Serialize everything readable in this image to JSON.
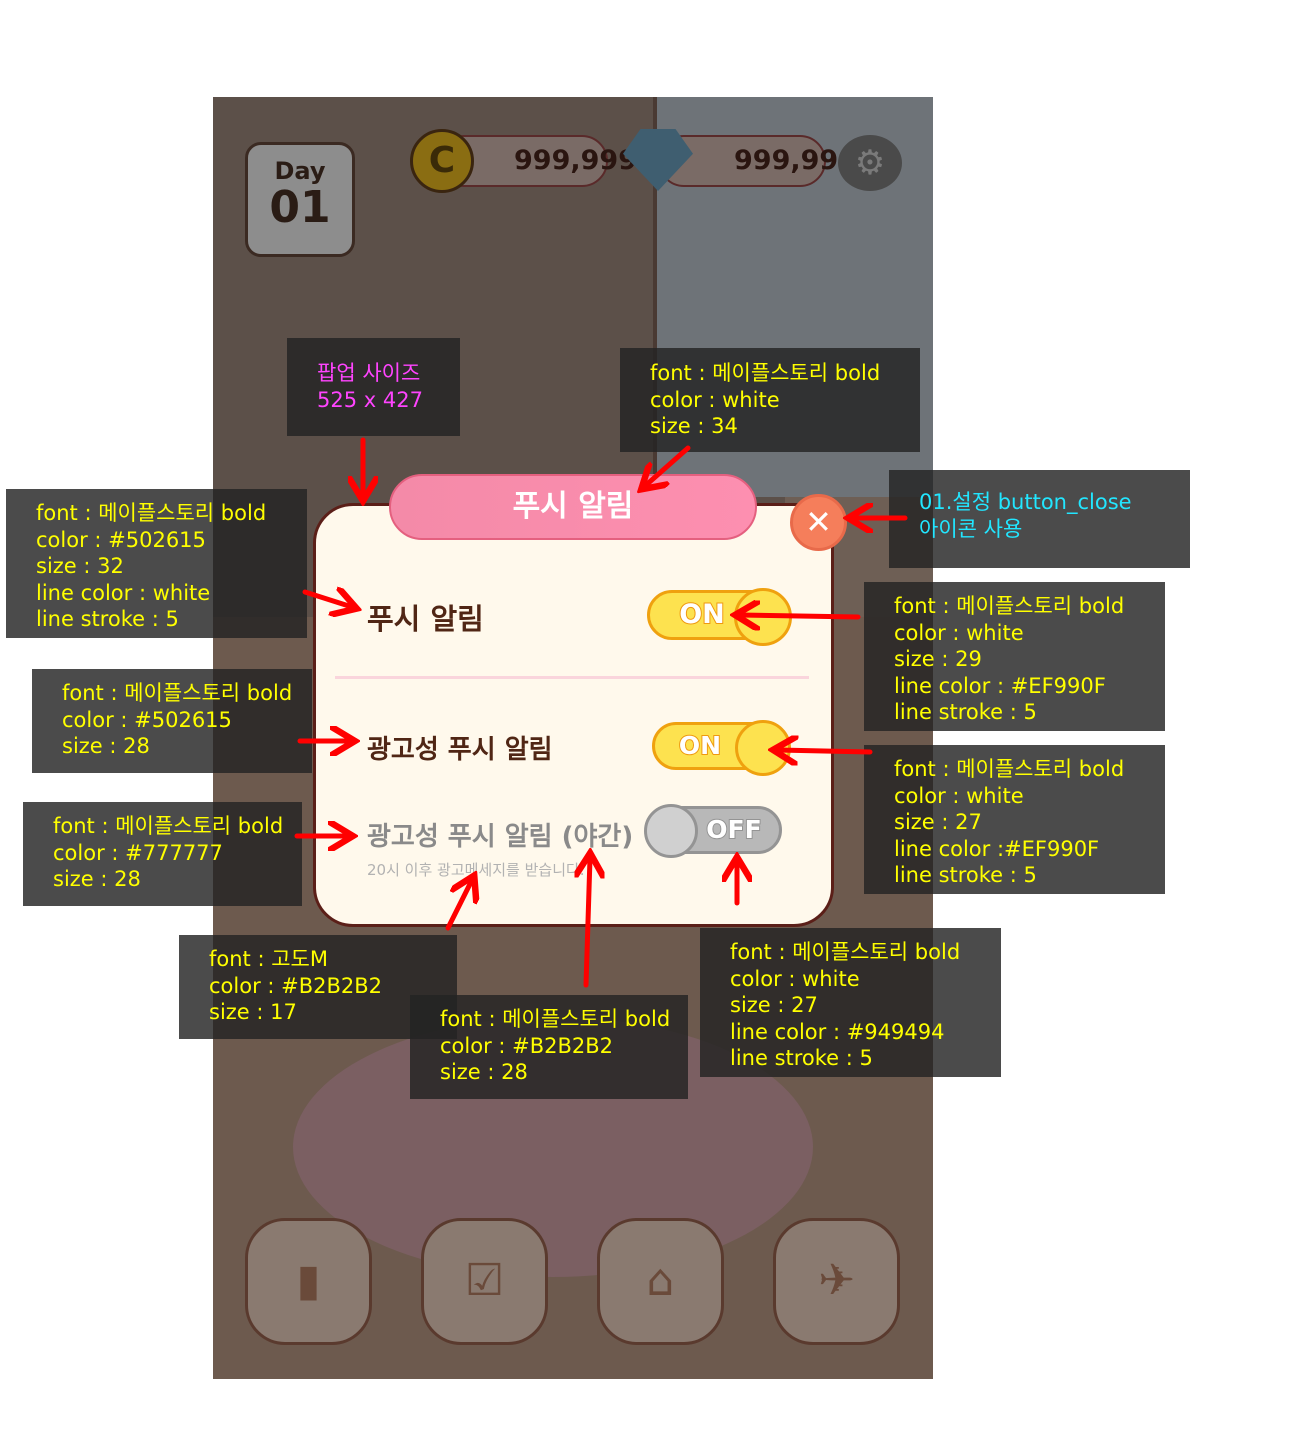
{
  "game": {
    "day_label": "Day",
    "day_number": "01",
    "coin_amount": "999,999",
    "gem_amount": "999,999",
    "icons": {
      "coin": "coin-icon",
      "gem": "diamond-icon",
      "settings": "gear-icon",
      "nav": [
        "chart-icon",
        "checklist-icon",
        "shop-icon",
        "airplane-character-icon"
      ]
    }
  },
  "popup": {
    "title": "푸시 알림",
    "close_icon": "close-x-icon",
    "rows": [
      {
        "label": "푸시 알림",
        "toggle": "ON",
        "state": true
      },
      {
        "label": "광고성 푸시 알림",
        "toggle": "ON",
        "state": true
      },
      {
        "label": "광고성 푸시 알림 (야간)",
        "sublabel": "20시 이후 광고메세지를 받습니다.",
        "toggle": "OFF",
        "state": false
      }
    ]
  },
  "annotations": {
    "popup_size": {
      "line1": "팝업 사이즈",
      "line2": "525 x 427"
    },
    "title": [
      "font : 메이플스토리 bold",
      "color : white",
      "size : 34"
    ],
    "close": [
      "01.설정 button_close",
      "아이콘 사용"
    ],
    "row1_label": [
      "font : 메이플스토리 bold",
      "color : #502615",
      "size : 32",
      "line color : white",
      "line stroke :  5"
    ],
    "row2_label": [
      "font : 메이플스토리 bold",
      "color : #502615",
      "size : 28"
    ],
    "row3_label": [
      "font : 메이플스토리 bold",
      "color : #777777",
      "size : 28"
    ],
    "toggle1": [
      "font : 메이플스토리 bold",
      "color : white",
      "size : 29",
      "line color : #EF990F",
      "line stroke :  5"
    ],
    "toggle2": [
      "font : 메이플스토리 bold",
      "color : white",
      "size : 27",
      "line color :#EF990F",
      "line stroke :  5"
    ],
    "sublabel": [
      "font : 고도M",
      "color : #B2B2B2",
      "size : 17"
    ],
    "row3_suffix": [
      "font : 메이플스토리 bold",
      "color : #B2B2B2",
      "size : 28"
    ],
    "toggle_off": [
      "font : 메이플스토리 bold",
      "color : white",
      "size : 27",
      "line color : #949494",
      "line stroke :  5"
    ]
  },
  "colors": {
    "label": "#502615",
    "label_disabled": "#777777",
    "sub": "#B2B2B2",
    "on_stroke": "#EF990F",
    "off_stroke": "#949494",
    "annotation_text": "#FFFF00",
    "arrow": "#FF0000"
  }
}
